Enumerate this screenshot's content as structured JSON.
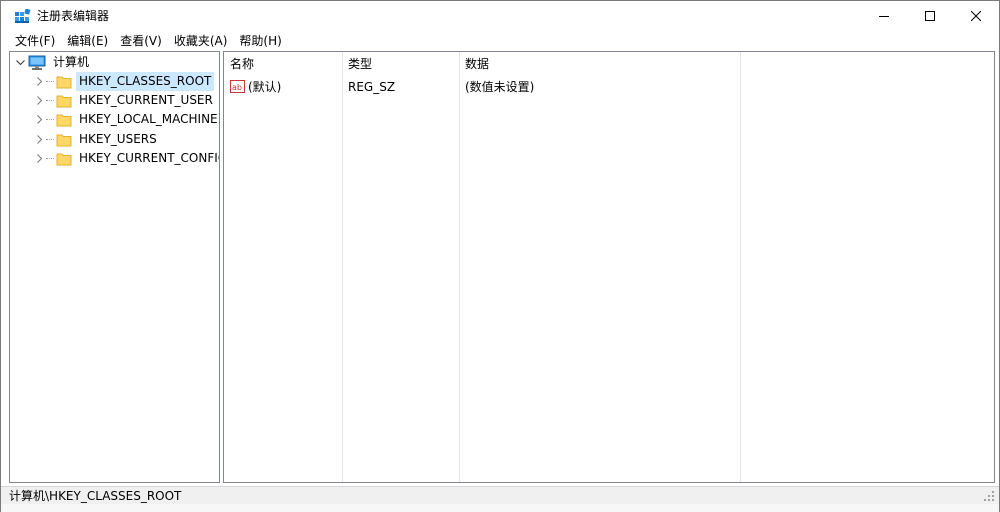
{
  "window": {
    "title": "注册表编辑器",
    "accent": "#0078d7"
  },
  "menu": [
    {
      "label": "文件(F)"
    },
    {
      "label": "编辑(E)"
    },
    {
      "label": "查看(V)"
    },
    {
      "label": "收藏夹(A)"
    },
    {
      "label": "帮助(H)"
    }
  ],
  "tree": {
    "root": {
      "label": "计算机",
      "icon": "computer-icon",
      "expanded": true
    },
    "children": [
      {
        "label": "HKEY_CLASSES_ROOT",
        "selected": true
      },
      {
        "label": "HKEY_CURRENT_USER",
        "selected": false
      },
      {
        "label": "HKEY_LOCAL_MACHINE",
        "selected": false
      },
      {
        "label": "HKEY_USERS",
        "selected": false
      },
      {
        "label": "HKEY_CURRENT_CONFIG",
        "selected": false
      }
    ],
    "selection_color": "#cce8ff"
  },
  "list": {
    "columns": [
      {
        "label": "名称"
      },
      {
        "label": "类型"
      },
      {
        "label": "数据"
      }
    ],
    "rows": [
      {
        "name": "(默认)",
        "type": "REG_SZ",
        "data": "(数值未设置)",
        "icon": "string-value-icon"
      }
    ]
  },
  "status": {
    "path": "计算机\\HKEY_CLASSES_ROOT"
  }
}
